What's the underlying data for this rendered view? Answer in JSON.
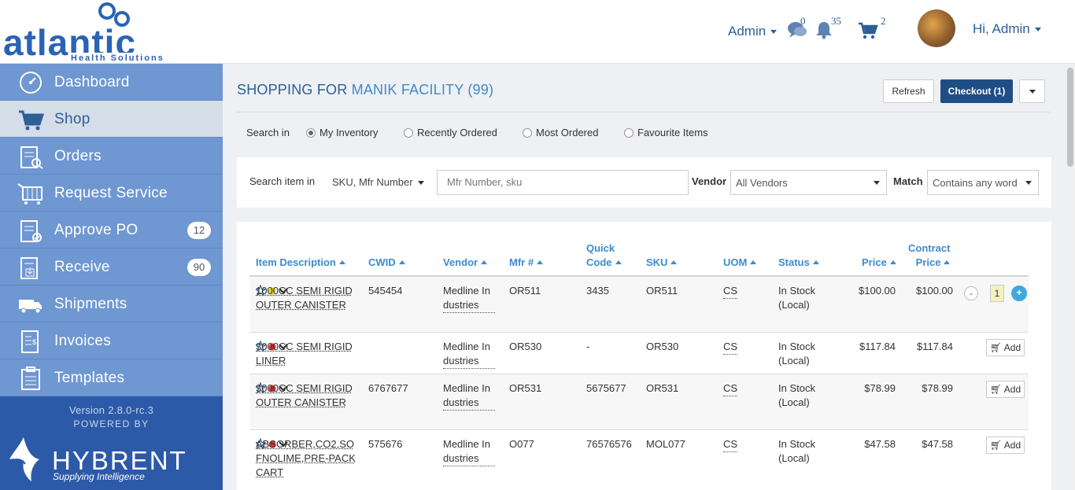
{
  "header": {
    "logo_text": "atlantic",
    "logo_sub": "Health Solutions",
    "role_menu": "Admin",
    "messages_count": "0",
    "notifications_count": "35",
    "cart_count": "2",
    "user_greeting": "Hi, Admin"
  },
  "sidebar": {
    "items": [
      {
        "label": "Dashboard",
        "icon": "dashboard-icon"
      },
      {
        "label": "Shop",
        "icon": "cart-icon"
      },
      {
        "label": "Orders",
        "icon": "orders-icon"
      },
      {
        "label": "Request Service",
        "icon": "service-icon"
      },
      {
        "label": "Approve PO",
        "icon": "approve-icon",
        "count": "12"
      },
      {
        "label": "Receive",
        "icon": "receive-icon",
        "count": "90"
      },
      {
        "label": "Shipments",
        "icon": "truck-icon"
      },
      {
        "label": "Invoices",
        "icon": "invoice-icon"
      },
      {
        "label": "Templates",
        "icon": "template-icon"
      }
    ],
    "version": "Version 2.8.0-rc.3",
    "powered_by": "POWERED BY",
    "brand": "HYBRENT",
    "tagline": "Supplying Intelligence"
  },
  "main": {
    "title_prefix": "SHOPPING FOR",
    "facility": "MANIK FACILITY (99)",
    "refresh_label": "Refresh",
    "checkout_label": "Checkout (1)",
    "search_in_label": "Search in",
    "radios": [
      {
        "label": "My Inventory",
        "selected": true
      },
      {
        "label": "Recently Ordered",
        "selected": false
      },
      {
        "label": "Most Ordered",
        "selected": false
      },
      {
        "label": "Favourite Items",
        "selected": false
      }
    ],
    "search_item_in_label": "Search item in",
    "search_field_selector": "SKU, Mfr Number",
    "search_placeholder": "Mfr Number, sku",
    "vendor_label": "Vendor",
    "vendor_value": "All Vendors",
    "match_label": "Match",
    "match_value": "Contains any word"
  },
  "table": {
    "headers": {
      "desc": "Item Description",
      "cwid": "CWID",
      "vendor": "Vendor",
      "mfr": "Mfr #",
      "quick1": "Quick",
      "quick2": "Code",
      "sku": "SKU",
      "uom": "UOM",
      "status": "Status",
      "price": "Price",
      "contract1": "Contract",
      "contract2": "Price"
    },
    "add_label": "Add",
    "rows": [
      {
        "status_color": "#e0d820",
        "desc": "1000CC SEMI RIGID OUTER CANISTER",
        "cwid": "545454",
        "vendor": "Medline Industries",
        "mfr": "OR511",
        "quick": "3435",
        "sku": "OR511",
        "uom": "CS",
        "status": "In Stock (Local)",
        "price": "$100.00",
        "contract": "$100.00",
        "qty": "1"
      },
      {
        "status_color": "#e03030",
        "desc": "3000CC SEMI RIGID LINER",
        "cwid": "",
        "vendor": "Medline Industries",
        "mfr": "OR530",
        "quick": "-",
        "sku": "OR530",
        "uom": "CS",
        "status": "In Stock (Local)",
        "price": "$117.84",
        "contract": "$117.84"
      },
      {
        "status_color": "#e03030",
        "desc": "3000CC SEMI RIGID OUTER CANISTER",
        "cwid": "6767677",
        "vendor": "Medline Industries",
        "mfr": "OR531",
        "quick": "5675677",
        "sku": "OR531",
        "uom": "CS",
        "status": "In Stock (Local)",
        "price": "$78.99",
        "contract": "$78.99"
      },
      {
        "status_color": "#e03030",
        "desc": "ABSORBER,CO2,SOFNOLIME,PRE-PACK CART",
        "cwid": "575676",
        "vendor": "Medline Industries",
        "mfr": "O077",
        "quick": "76576576",
        "sku": "MOL077",
        "uom": "CS",
        "status": "In Stock (Local)",
        "price": "$47.58",
        "contract": "$47.58"
      }
    ]
  }
}
